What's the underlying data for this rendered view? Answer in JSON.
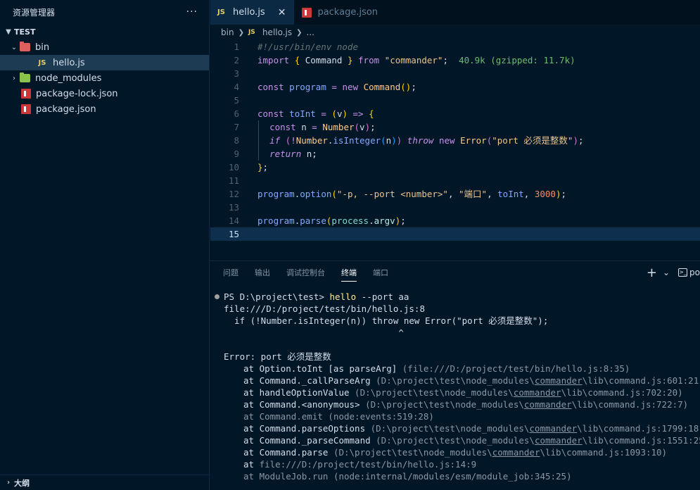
{
  "sidebar": {
    "title": "资源管理器",
    "more": "···",
    "section": "TEST",
    "tree": [
      {
        "label": "bin",
        "kind": "folder"
      },
      {
        "label": "hello.js",
        "kind": "js"
      },
      {
        "label": "node_modules",
        "kind": "folder"
      },
      {
        "label": "package-lock.json",
        "kind": "npm"
      },
      {
        "label": "package.json",
        "kind": "npm"
      }
    ],
    "outline": "大纲"
  },
  "editor": {
    "tabs": [
      {
        "label": "hello.js",
        "icon": "JS",
        "close": "✕"
      },
      {
        "label": "package.json"
      }
    ],
    "breadcrumb": [
      "bin",
      "hello.js",
      "..."
    ],
    "line_numbers": [
      "1",
      "2",
      "3",
      "4",
      "5",
      "6",
      "7",
      "8",
      "9",
      "10",
      "11",
      "12",
      "13",
      "14",
      "15"
    ],
    "code": {
      "l1": "#!/usr/bin/env node",
      "l2_import": "import",
      "l2_name": "Command",
      "l2_from": "from",
      "l2_mod": "\"commander\"",
      "l2_hint": "40.9k (gzipped: 11.7k)",
      "l4_const": "const",
      "l4_var": "program",
      "l4_new": "new",
      "l4_cls": "Command",
      "l6_const": "const",
      "l6_var": "toInt",
      "l6_param": "v",
      "l7_const": "const",
      "l7_var": "n",
      "l7_fn": "Number",
      "l7_arg": "v",
      "l8_if": "if",
      "l8_obj": "Number",
      "l8_fn": "isInteger",
      "l8_arg": "n",
      "l8_throw": "throw",
      "l8_new": "new",
      "l8_cls": "Error",
      "l8_str": "\"port 必须是整数\"",
      "l9_return": "return",
      "l9_var": "n",
      "l12_obj": "program",
      "l12_fn": "option",
      "l12_s1": "\"-p, --port <number>\"",
      "l12_s2": "\"端口\"",
      "l12_ref": "toInt",
      "l12_num": "3000",
      "l14_obj": "program",
      "l14_fn": "parse",
      "l14_proc": "process",
      "l14_argv": "argv"
    }
  },
  "panel": {
    "tabs": [
      "问题",
      "输出",
      "调试控制台",
      "终端",
      "端口"
    ],
    "active_tab": "终端",
    "actions": {
      "add": "+",
      "chevron": "⌄",
      "shell": "po"
    },
    "terminal": {
      "prompt": "PS D:\\project\\test>",
      "command": "hello",
      "args": "--port aa",
      "lines": [
        "file:///D:/project/test/bin/hello.js:8",
        "  if (!Number.isInteger(n)) throw new Error(\"port 必须是整数\");",
        "                                 ^",
        "",
        "Error: port 必须是整数"
      ],
      "stack": [
        {
          "at": "at Option.toInt [as parseArg]",
          "loc": "(file:///D:/project/test/bin/hello.js:8:35)",
          "dim": false
        },
        {
          "at": "at Command._callParseArg",
          "loc": "(D:\\project\\test\\node_modules\\commander\\lib\\command.js:601:21)",
          "dim": false
        },
        {
          "at": "at handleOptionValue",
          "loc": "(D:\\project\\test\\node_modules\\commander\\lib\\command.js:702:20)",
          "dim": false
        },
        {
          "at": "at Command.<anonymous>",
          "loc": "(D:\\project\\test\\node_modules\\commander\\lib\\command.js:722:7)",
          "dim": false
        },
        {
          "at": "at Command.emit",
          "loc": "(node:events:519:28)",
          "dim": true
        },
        {
          "at": "at Command.parseOptions",
          "loc": "(D:\\project\\test\\node_modules\\commander\\lib\\command.js:1799:18)",
          "dim": false
        },
        {
          "at": "at Command._parseCommand",
          "loc": "(D:\\project\\test\\node_modules\\commander\\lib\\command.js:1551:25)",
          "dim": false
        },
        {
          "at": "at Command.parse",
          "loc": "(D:\\project\\test\\node_modules\\commander\\lib\\command.js:1093:10)",
          "dim": false
        },
        {
          "at": "at",
          "loc": "file:///D:/project/test/bin/hello.js:14:9",
          "dim": false
        },
        {
          "at": "at ModuleJob.run",
          "loc": "(node:internal/modules/esm/module_job:345:25)",
          "dim": true
        }
      ]
    }
  }
}
